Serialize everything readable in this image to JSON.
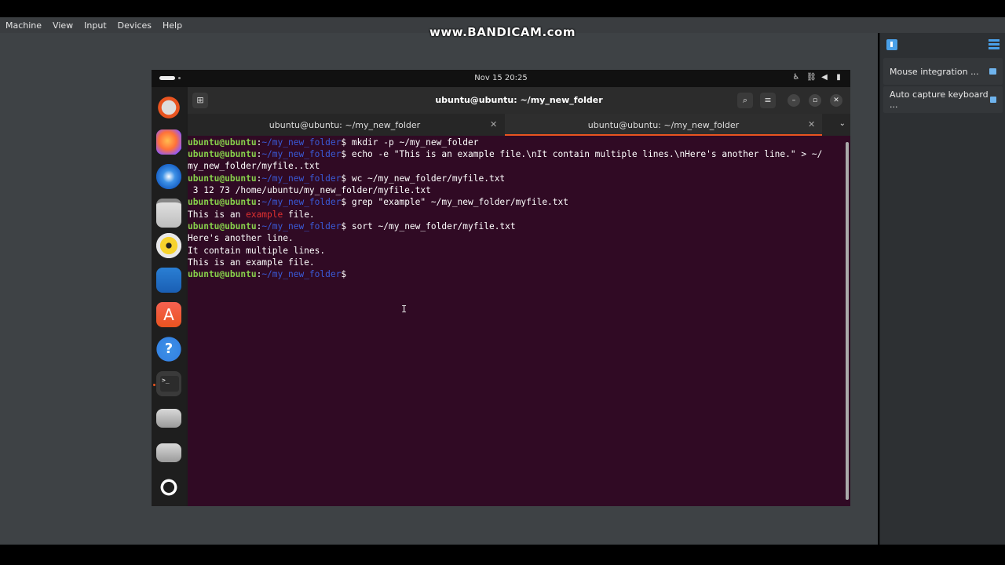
{
  "host": {
    "menu": [
      "Machine",
      "View",
      "Input",
      "Devices",
      "Help"
    ],
    "watermark": "www.BANDICAM.com",
    "side_panel": {
      "items": [
        {
          "label": "Mouse integration ..."
        },
        {
          "label": "Auto capture keyboard ..."
        }
      ]
    }
  },
  "guest": {
    "clock": "Nov 15  20:25",
    "dock_apps": [
      "ubuntu-bag-icon",
      "firefox-icon",
      "thunderbird-icon",
      "files-icon",
      "rhythmbox-icon",
      "writer-icon",
      "app-center-icon",
      "help-icon",
      "terminal-icon",
      "drive-icon",
      "drive-icon",
      "ubuntu-logo-icon"
    ],
    "terminal": {
      "title": "ubuntu@ubuntu: ~/my_new_folder",
      "tabs": [
        {
          "label": "ubuntu@ubuntu: ~/my_new_folder",
          "active": false
        },
        {
          "label": "ubuntu@ubuntu: ~/my_new_folder",
          "active": true
        }
      ],
      "prompt_user": "ubuntu@ubuntu",
      "prompt_sep": ":",
      "prompt_path": "~/my_new_folder",
      "prompt_dollar": "$",
      "lines": {
        "l1_cmd": " mkdir -p ~/my_new_folder",
        "l2_cmd": " echo -e \"This is an example file.\\nIt contain multiple lines.\\nHere's another line.\" > ~/",
        "l3_text": "my_new_folder/myfile..txt",
        "l4_cmd": " wc ~/my_new_folder/myfile.txt",
        "l5_text": " 3 12 73 /home/ubuntu/my_new_folder/myfile.txt",
        "l6_cmd": " grep \"example\" ~/my_new_folder/myfile.txt",
        "l7_pre": "This is an ",
        "l7_match": "example",
        "l7_post": " file.",
        "l8_cmd": " sort ~/my_new_folder/myfile.txt",
        "l9_text": "Here's another line.",
        "l10_text": "It contain multiple lines.",
        "l11_text": "This is an example file."
      }
    }
  },
  "colors": {
    "terminal_bg": "#300a24",
    "prompt_user": "#87d04b",
    "prompt_path": "#3a5bd9",
    "match": "#e03030",
    "accent": "#e95420"
  }
}
